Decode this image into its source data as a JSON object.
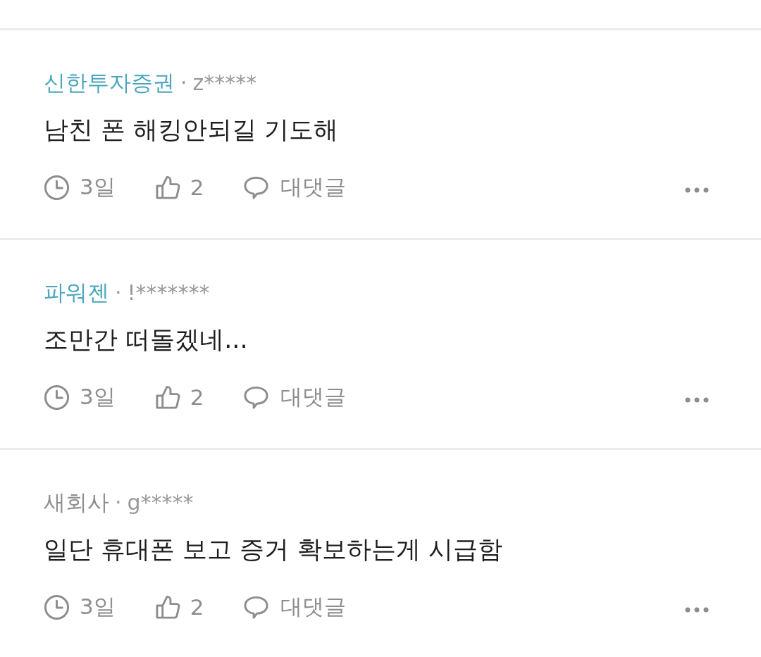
{
  "comments": [
    {
      "company": "신한투자증권",
      "color": "#4ba6bc",
      "separator": "·",
      "author": "z*****",
      "text": "남친 폰 해킹안되길 기도해",
      "time": "3일",
      "likes": "2",
      "reply_label": "대댓글"
    },
    {
      "company": "파워젠",
      "color": "#4ba6bc",
      "separator": "·",
      "author": "!*******",
      "text": "조만간 떠돌겠네...",
      "time": "3일",
      "likes": "2",
      "reply_label": "대댓글"
    },
    {
      "company": "새회사",
      "color": "#8e8e8e",
      "separator": "·",
      "author": "g*****",
      "text": "일단 휴대폰 보고 증거 확보하는게 시급함",
      "time": "3일",
      "likes": "2",
      "reply_label": "대댓글"
    }
  ]
}
